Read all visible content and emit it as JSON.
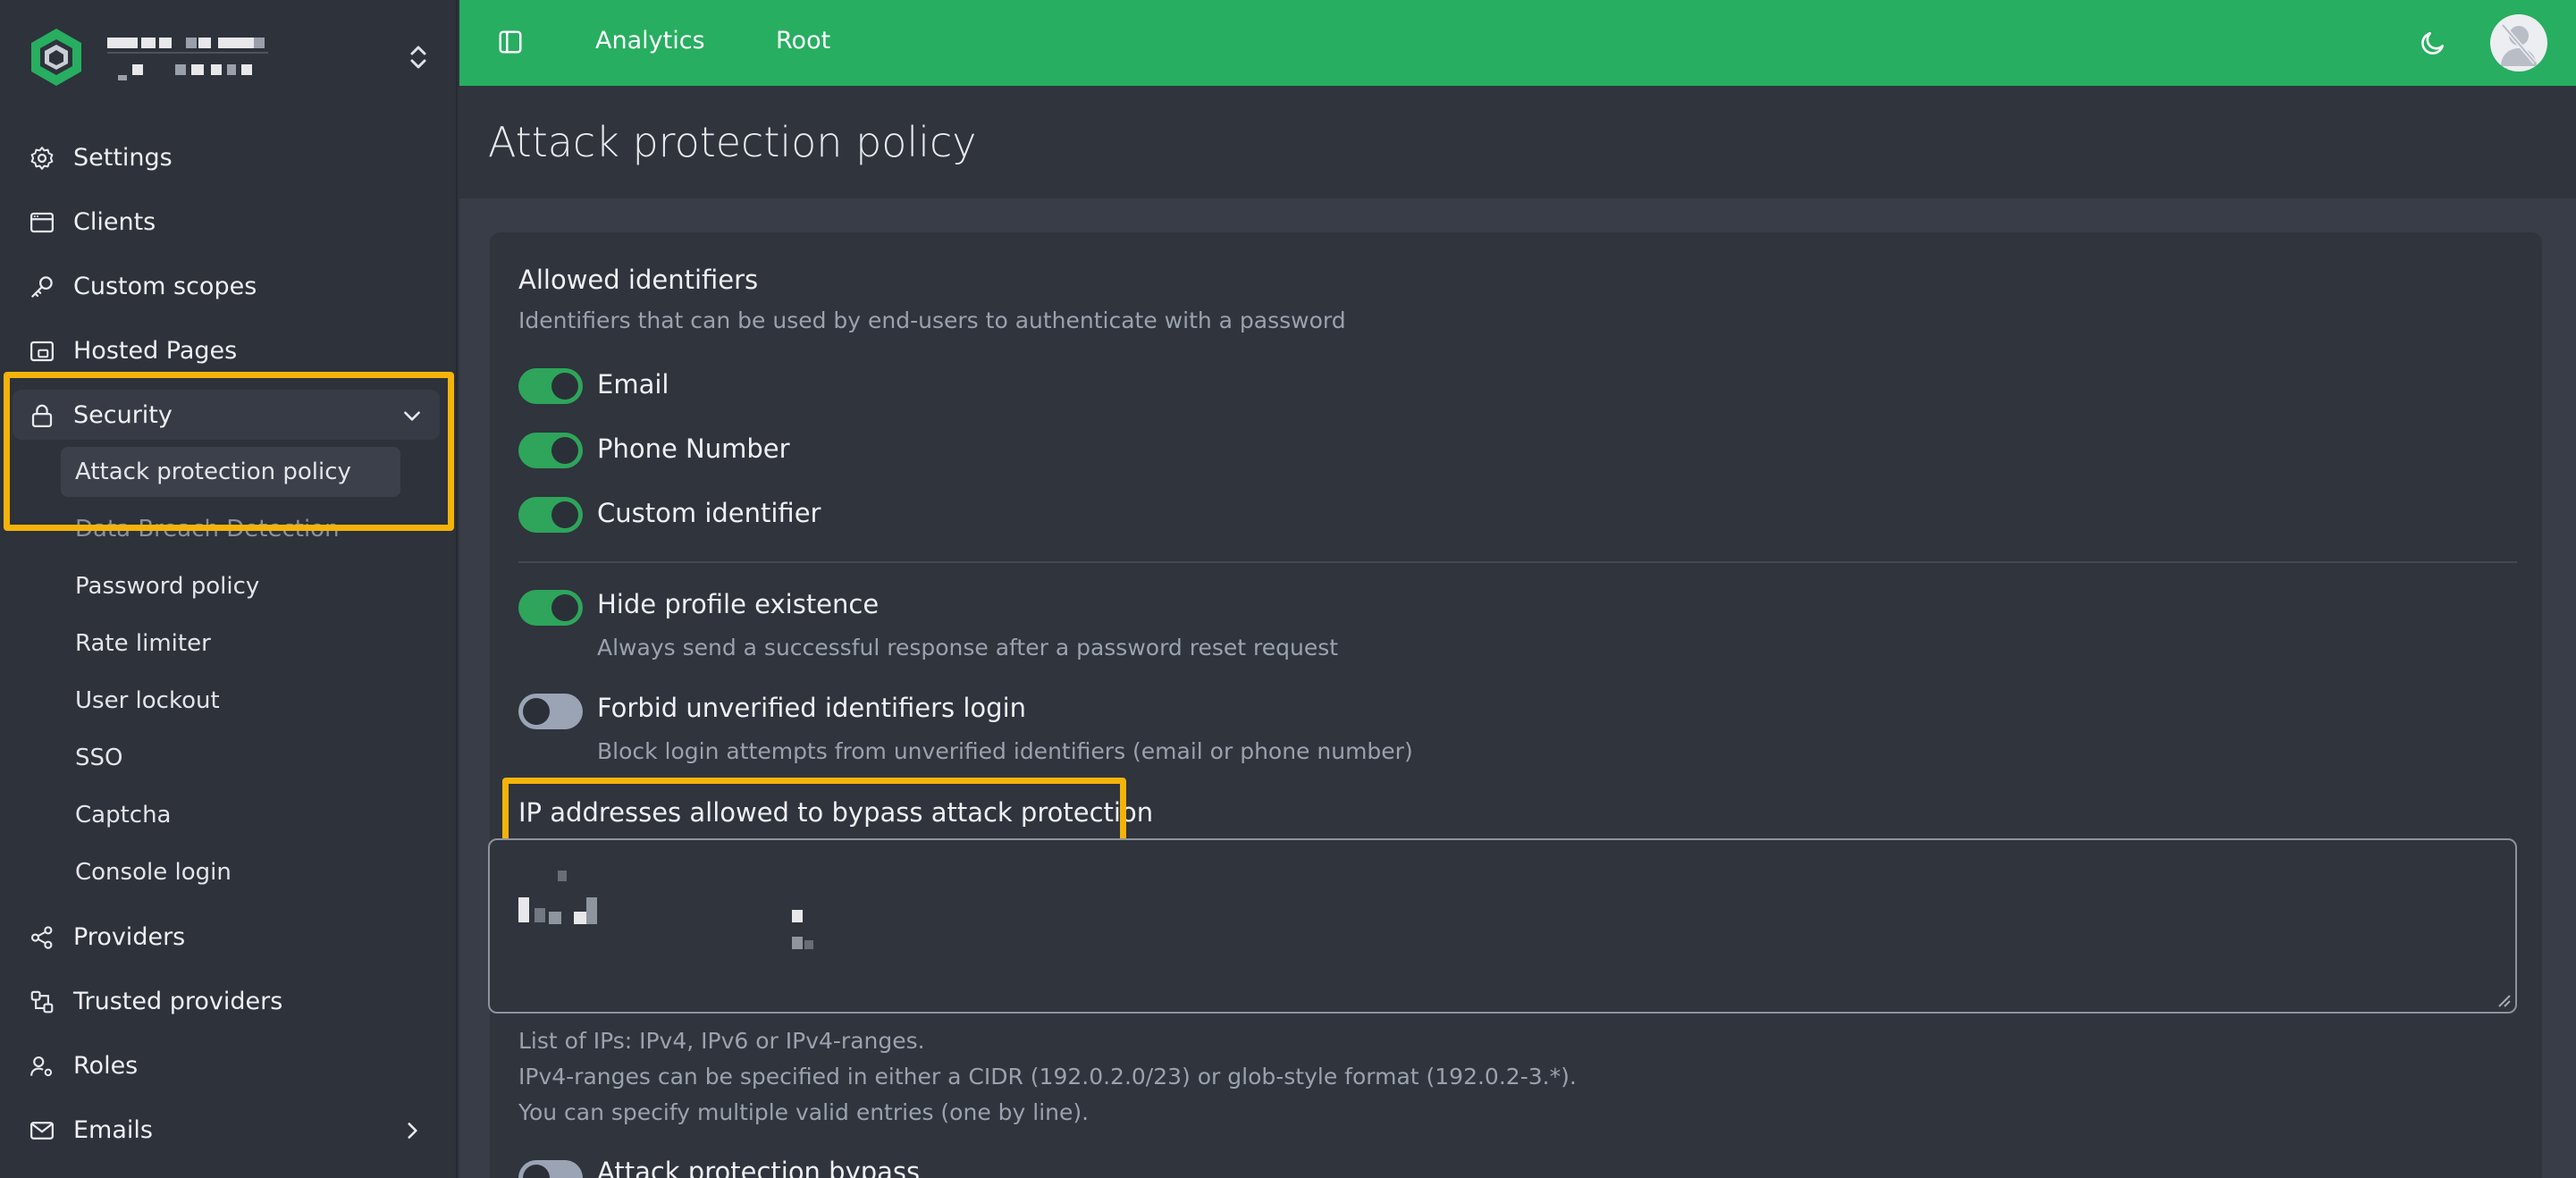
{
  "sidebar": {
    "nav_top": [
      {
        "label": "Settings",
        "icon": "gear-icon"
      },
      {
        "label": "Clients",
        "icon": "browser-window-icon"
      },
      {
        "label": "Custom scopes",
        "icon": "key-icon"
      },
      {
        "label": "Hosted Pages",
        "icon": "hosted-pages-icon"
      }
    ],
    "security": {
      "label": "Security",
      "icon": "lock-icon",
      "items": [
        {
          "label": "Attack protection policy"
        },
        {
          "label": "Data Breach Detection"
        },
        {
          "label": "Password policy"
        },
        {
          "label": "Rate limiter"
        },
        {
          "label": "User lockout"
        },
        {
          "label": "SSO"
        },
        {
          "label": "Captcha"
        },
        {
          "label": "Console login"
        }
      ]
    },
    "nav_bottom": [
      {
        "label": "Providers",
        "icon": "share-nodes-icon"
      },
      {
        "label": "Trusted providers",
        "icon": "trusted-providers-icon"
      },
      {
        "label": "Roles",
        "icon": "user-roles-icon"
      },
      {
        "label": "Emails",
        "icon": "mail-icon"
      }
    ]
  },
  "topbar": {
    "links": [
      "Analytics",
      "Root"
    ],
    "accent_color": "#27ae60"
  },
  "page": {
    "title": "Attack protection policy"
  },
  "form": {
    "allowed_identifiers": {
      "title": "Allowed identifiers",
      "description": "Identifiers that can be used by end-users to authenticate with a password",
      "toggles": [
        {
          "label": "Email",
          "checked": true
        },
        {
          "label": "Phone Number",
          "checked": true
        },
        {
          "label": "Custom identifier",
          "checked": true
        }
      ]
    },
    "hide_profile": {
      "label": "Hide profile existence",
      "description": "Always send a successful response after a password reset request",
      "checked": true
    },
    "forbid_unverified": {
      "label": "Forbid unverified identifiers login",
      "description": "Block login attempts from unverified identifiers (email or phone number)",
      "checked": false
    },
    "ip_bypass": {
      "title": "IP addresses allowed to bypass attack protection",
      "help": [
        "List of IPs: IPv4, IPv6 or IPv4-ranges.",
        "IPv4-ranges can be specified in either a CIDR (192.0.2.0/23) or glob-style format (192.0.2-3.*).",
        "You can specify multiple valid entries (one by line)."
      ]
    },
    "attack_bypass": {
      "label": "Attack protection bypass",
      "checked": false
    }
  },
  "highlight_color": "#f4b30a"
}
